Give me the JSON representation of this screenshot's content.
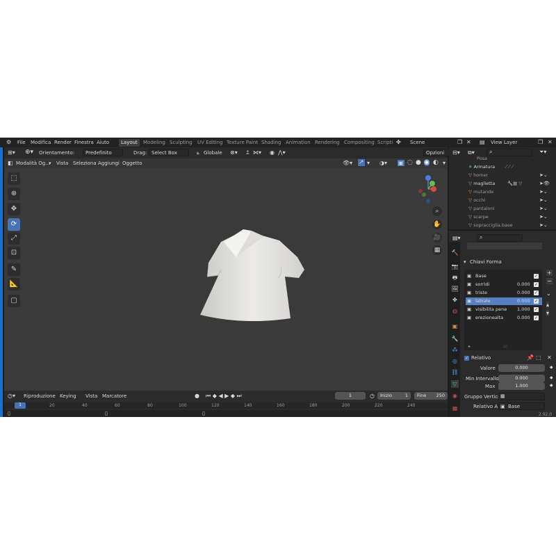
{
  "menu": [
    "File",
    "Modifica",
    "Render",
    "Finestra",
    "Aiuto"
  ],
  "workspaces": [
    "Layout",
    "Modeling",
    "Sculpting",
    "UV Editing",
    "Texture Paint",
    "Shading",
    "Animation",
    "Rendering",
    "Compositing",
    "Scripti"
  ],
  "active_workspace": "Layout",
  "scene": "Scene",
  "view_layer": "View Layer",
  "tool_header": {
    "orientation_label": "Orientamento:",
    "orientation_value": "Predefinito",
    "drag_label": "Drag:",
    "drag_value": "Select Box",
    "transform_value": "Globale",
    "options": "Opzioni"
  },
  "viewport_header": {
    "mode": "Modalità Og...",
    "items": [
      "Vista",
      "Seleziona",
      "Aggiungi",
      "Oggetto"
    ]
  },
  "gizmo": {
    "x": "X",
    "y": "Y",
    "z": "Z"
  },
  "outliner": {
    "items": [
      {
        "name": "Posa"
      },
      {
        "name": "Armatura"
      },
      {
        "name": "homer"
      },
      {
        "name": "maglietta"
      },
      {
        "name": "mutande"
      },
      {
        "name": "occhi"
      },
      {
        "name": "pantaloni"
      },
      {
        "name": "scarpe"
      },
      {
        "name": "sopracciglia.base"
      }
    ]
  },
  "properties": {
    "section_title": "Chiavi Forma",
    "shape_keys": [
      {
        "name": "Base",
        "value": ""
      },
      {
        "name": "sorridi",
        "value": "0.000"
      },
      {
        "name": "triste",
        "value": "0.000"
      },
      {
        "name": "labiale",
        "value": "0.000"
      },
      {
        "name": "visibilita pene",
        "value": "1.000"
      },
      {
        "name": "erezionealta",
        "value": "0.000"
      }
    ],
    "selected_index": 3,
    "relativo_label": "Relativo",
    "valore_label": "Valore",
    "valore_value": "0.000",
    "min_label": "Min Intervallo",
    "min_value": "0.000",
    "max_label": "Max",
    "max_value": "1.000",
    "gruppo_label": "Gruppo Vertici",
    "relativo_a_label": "Relativo A",
    "relativo_a_value": "Base",
    "list_footer": ":::"
  },
  "timeline": {
    "items": [
      "Riproduzione",
      "Keying",
      "Vista",
      "Marcatore"
    ],
    "current_frame": "1",
    "inizio_label": "Inizio",
    "inizio_value": "1",
    "fine_label": "Fine",
    "fine_value": "250",
    "ruler": [
      "0",
      "20",
      "40",
      "60",
      "80",
      "100",
      "120",
      "140",
      "160",
      "180",
      "200",
      "220",
      "240"
    ]
  },
  "version": "2.92.0",
  "colors": {
    "accent": "#4772b3",
    "viewport": "#3a3a3a",
    "panel": "#2b2b2b"
  }
}
